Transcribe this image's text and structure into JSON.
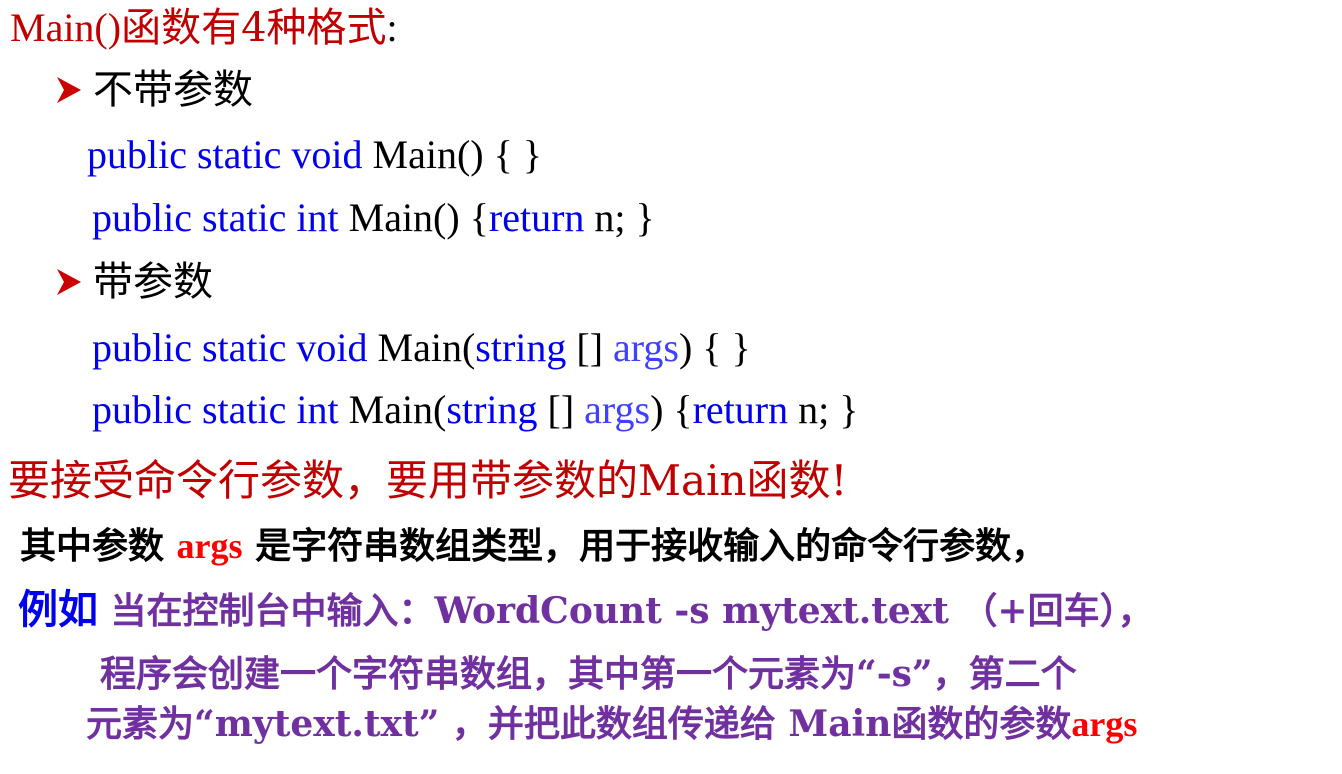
{
  "title": {
    "main": "Main()",
    "rest": "函数有4种格式",
    "colon": ":"
  },
  "bullet1": {
    "label": "不带参数"
  },
  "code1": {
    "kw": "public static void",
    "main": "Main() { }"
  },
  "code2": {
    "kw": "public static int",
    "main": "Main() {",
    "ret": "return",
    "tail": "n;   }"
  },
  "bullet2": {
    "label": "带参数"
  },
  "code3": {
    "kw": "public static void",
    "main": "Main(",
    "type": "string",
    "brackets": "[]",
    "args": "args",
    "tail": ") { }"
  },
  "code4": {
    "kw": "public static int",
    "main": "Main(",
    "type": "string",
    "brackets": "[]",
    "args": "args",
    "mid": ") {",
    "ret": "return",
    "tail": "n;   }"
  },
  "notice": {
    "text": "要接受命令行参数，要用带参数的Main函数!"
  },
  "explain1": {
    "before": "其中参数 ",
    "args": "args",
    "after": " 是字符串数组类型，用于接收输入的命令行参数，"
  },
  "explain2": {
    "example": "例如",
    "text": " 当在控制台中输入：WordCount  -s  mytext.text （+回车），"
  },
  "explain3": {
    "text": "程序会创建一个字符串数组，其中第一个元素为“-s”，第二个"
  },
  "explain4": {
    "text": "元素为“mytext.txt” ，并把此数组传递给 Main函数的参数",
    "args": "args"
  },
  "colors": {
    "arrow": "#cc0000",
    "code_keyword": "#0000ee",
    "title": "#c00000",
    "example_text": "#7030a0"
  }
}
